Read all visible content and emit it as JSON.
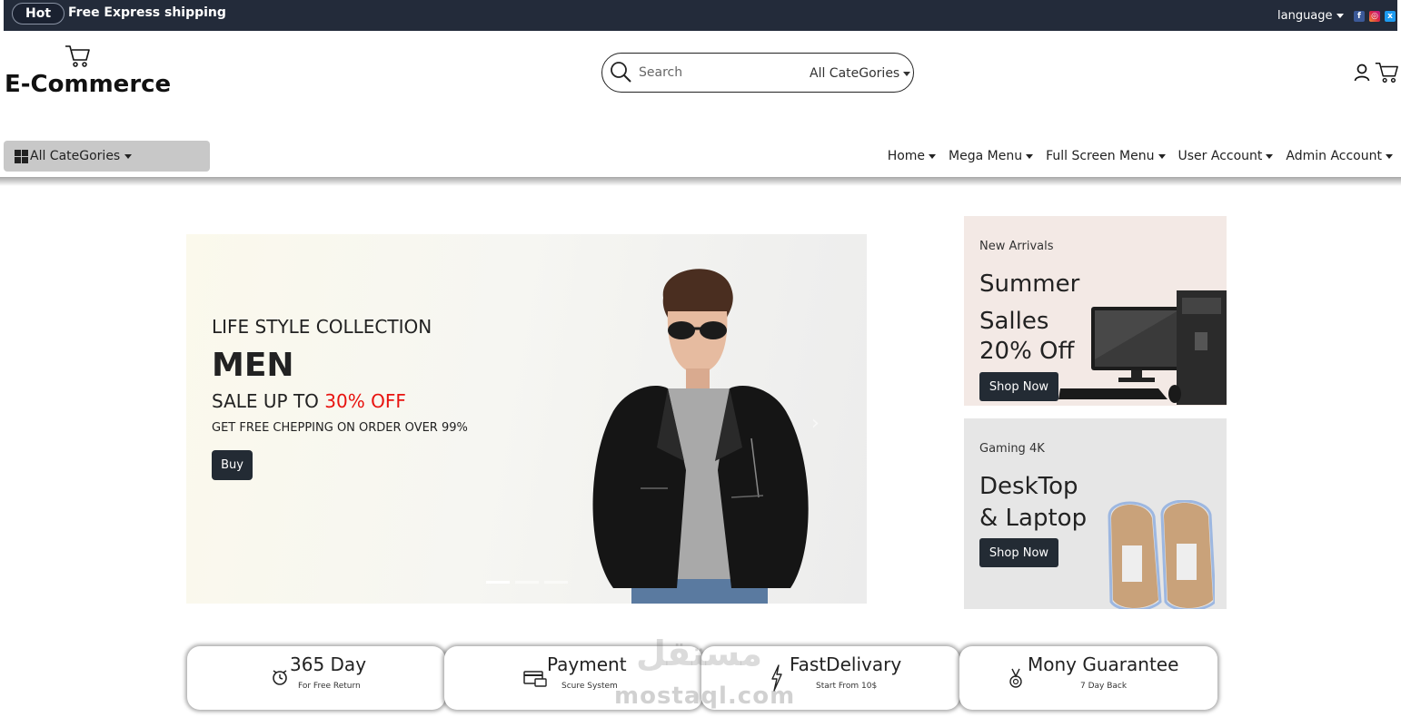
{
  "topbar": {
    "hot": "Hot",
    "shipping": "Free Express shipping",
    "language": "language"
  },
  "header": {
    "logo": "E-Commerce",
    "search_placeholder": "Search",
    "search_category": "All CateGories"
  },
  "nav": {
    "all_categories": "All CateGories",
    "menu": [
      "Home",
      "Mega Menu",
      "Full Screen Menu",
      "User Account",
      "Admin Account"
    ]
  },
  "hero": {
    "subtitle": "LIFE STYLE COLLECTION",
    "title": "MEN",
    "sale_prefix": "SALE UP TO ",
    "sale_highlight": "30% OFF",
    "free": "GET FREE CHEPPING ON ORDER OVER 99%",
    "buy": "Buy"
  },
  "side_banners": [
    {
      "small": "New Arrivals",
      "lines": [
        "Summer",
        "Salles",
        "20% Off"
      ],
      "button": "Shop Now"
    },
    {
      "small": "Gaming 4K",
      "lines": [
        "DeskTop",
        "& Laptop"
      ],
      "button": "Shop Now"
    }
  ],
  "features": [
    {
      "title": "365 Day",
      "sub": "For Free Return",
      "icon": "alarm-clock-icon"
    },
    {
      "title": "Payment",
      "sub": "Scure System",
      "icon": "credit-card-icon"
    },
    {
      "title": "FastDelivary",
      "sub": "Start From 10$",
      "icon": "lightning-icon"
    },
    {
      "title": "Mony Guarantee",
      "sub": "7 Day Back",
      "icon": "medal-icon"
    }
  ],
  "watermark": {
    "latin": "mostaql.com",
    "arabic": "مستقل"
  },
  "colors": {
    "topbar": "#232b3a",
    "accent_red": "#e8130f",
    "button_dark": "#232b34"
  }
}
